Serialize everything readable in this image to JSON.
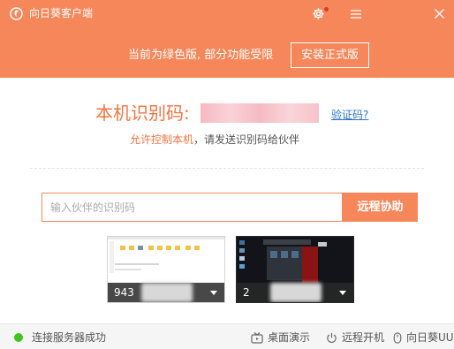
{
  "titlebar": {
    "title": "向日葵客户端"
  },
  "notice": {
    "text": "当前为绿色版, 部分功能受限",
    "install_label": "安装正式版"
  },
  "identity": {
    "label": "本机识别码:",
    "verify_link": "验证码?"
  },
  "hint": {
    "highlight": "允许控制本机",
    "rest": "，请发送识别码给伙伴"
  },
  "connect": {
    "placeholder": "输入伙伴的识别码",
    "value": "",
    "button_label": "远程协助"
  },
  "recent_devices": [
    {
      "label": "943"
    },
    {
      "label": "2"
    }
  ],
  "status": {
    "text": "连接服务器成功",
    "desktop_demo": "桌面演示",
    "remote_boot": "远程开机",
    "sunflower_uu": "向日葵UU"
  },
  "colors": {
    "accent": "#f6875a",
    "text_accent": "#f37442",
    "link": "#2d74c9",
    "online": "#3fc41f",
    "notification": "#e8352a"
  }
}
